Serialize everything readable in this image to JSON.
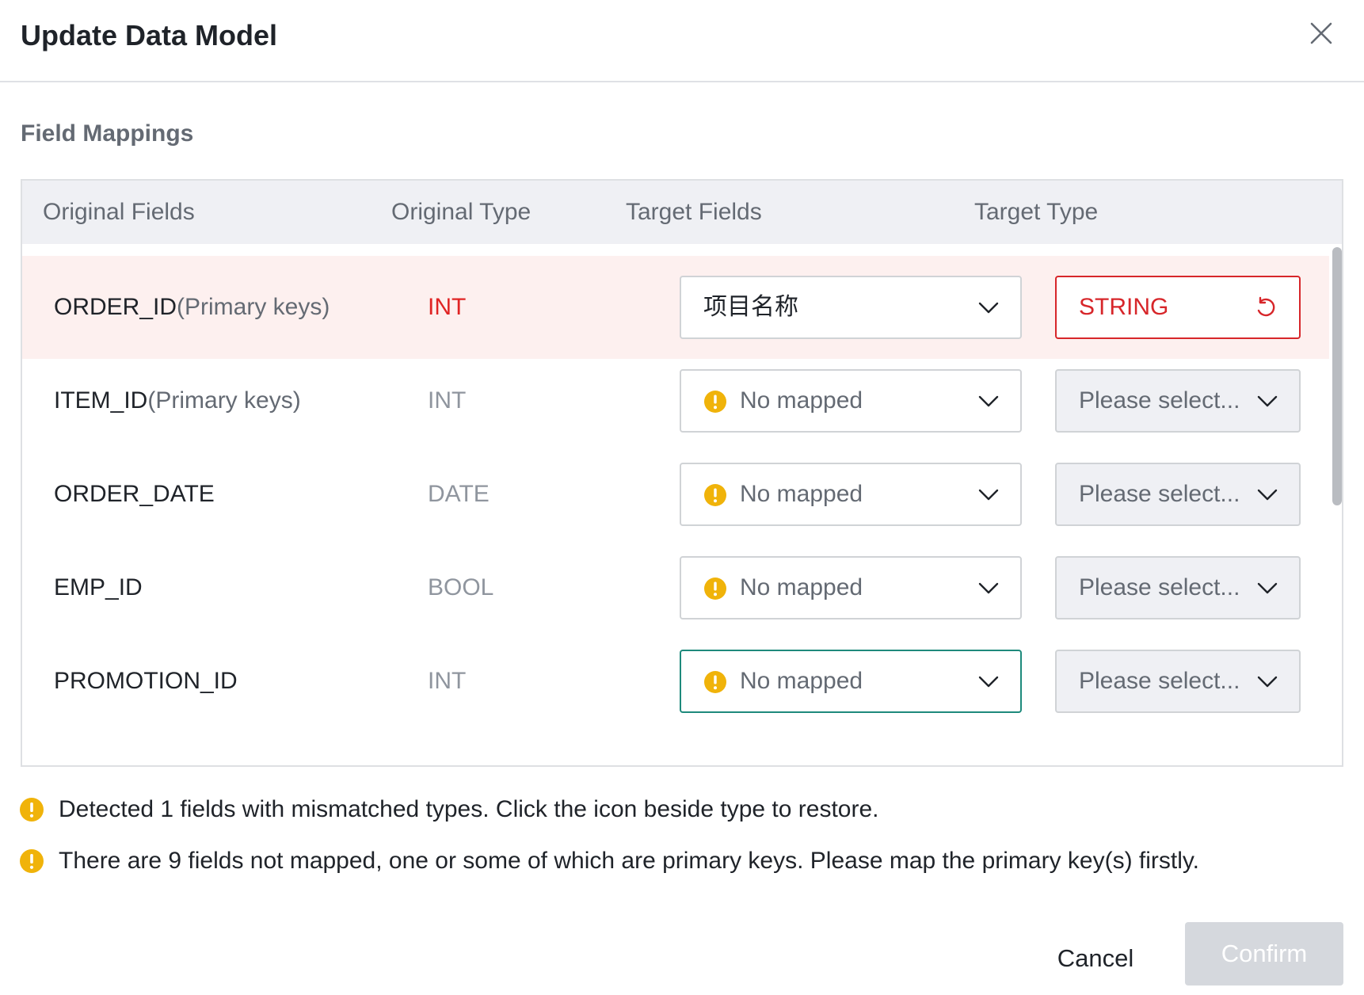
{
  "dialog": {
    "title": "Update Data Model",
    "close_icon": "close-icon"
  },
  "section_title": "Field Mappings",
  "table": {
    "columns": [
      "Original Fields",
      "Original Type",
      "Target Fields",
      "Target Type"
    ],
    "rows": [
      {
        "field": "ORDER_ID",
        "pk": "(Primary keys)",
        "type": "INT",
        "target_field": "项目名称",
        "target_type": "STRING",
        "state": "error"
      },
      {
        "field": "ITEM_ID",
        "pk": "(Primary keys)",
        "type": "INT",
        "target_field": "No mapped",
        "target_type": "Please select...",
        "state": "unmapped"
      },
      {
        "field": "ORDER_DATE",
        "pk": "",
        "type": "DATE",
        "target_field": "No mapped",
        "target_type": "Please select...",
        "state": "unmapped"
      },
      {
        "field": "EMP_ID",
        "pk": "",
        "type": "BOOL",
        "target_field": "No mapped",
        "target_type": "Please select...",
        "state": "unmapped"
      },
      {
        "field": "PROMOTION_ID",
        "pk": "",
        "type": "INT",
        "target_field": "No mapped",
        "target_type": "Please select...",
        "state": "unmapped-focused"
      }
    ]
  },
  "notices": [
    "Detected 1 fields with mismatched types. Click the icon beside type to restore.",
    "There are 9 fields not mapped, one or some of which are primary keys. Please map the primary key(s) firstly."
  ],
  "footer": {
    "cancel_label": "Cancel",
    "confirm_label": "Confirm"
  },
  "colors": {
    "error": "#d7262a",
    "warning": "#f0b30a",
    "error_row_bg": "#fdf0ef",
    "focus_border": "#1e8a7c",
    "confirm_disabled_bg": "#d5d8dd"
  }
}
